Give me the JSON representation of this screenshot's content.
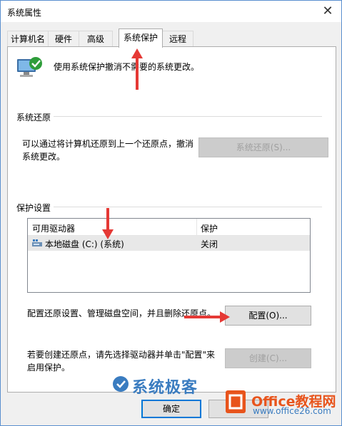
{
  "window": {
    "title": "系统属性",
    "close_glyph": "✕"
  },
  "tabs": [
    {
      "label": "计算机名"
    },
    {
      "label": "硬件"
    },
    {
      "label": "高级"
    },
    {
      "label": "系统保护",
      "active": true
    },
    {
      "label": "远程"
    }
  ],
  "intro": {
    "text": "使用系统保护撤消不需要的系统更改。",
    "icon": "system-computer-icon"
  },
  "restore": {
    "group_label": "系统还原",
    "description": "可以通过将计算机还原到上一个还原点，撤消系统更改。",
    "description_line1": "可以通过将计算机还原到上一个还原点，撤消",
    "description_line2": "系统更改。",
    "button": "系统还原(S)..."
  },
  "protection": {
    "group_label": "保护设置",
    "columns": [
      "可用驱动器",
      "保护"
    ],
    "rows": [
      {
        "drive": "本地磁盘 (C:) (系统)",
        "status": "关闭",
        "icon": "drive-icon"
      }
    ],
    "configure_text": "配置还原设置、管理磁盘空间，并且删除还原点。",
    "configure_button": "配置(O)...",
    "create_text_line1": "若要创建还原点，请先选择驱动器并单击\"配置\"来",
    "create_text_line2": "启用保护。",
    "create_button": "创建(C)..."
  },
  "footer": {
    "ok_button": "确定"
  },
  "watermark": {
    "brand": "系统极客",
    "office_name": "Office教程网",
    "office_url": "www.office26.com"
  },
  "colors": {
    "accent": "#0078d7",
    "arrow": "#e53935",
    "disabled_text": "#a0a0a0"
  }
}
